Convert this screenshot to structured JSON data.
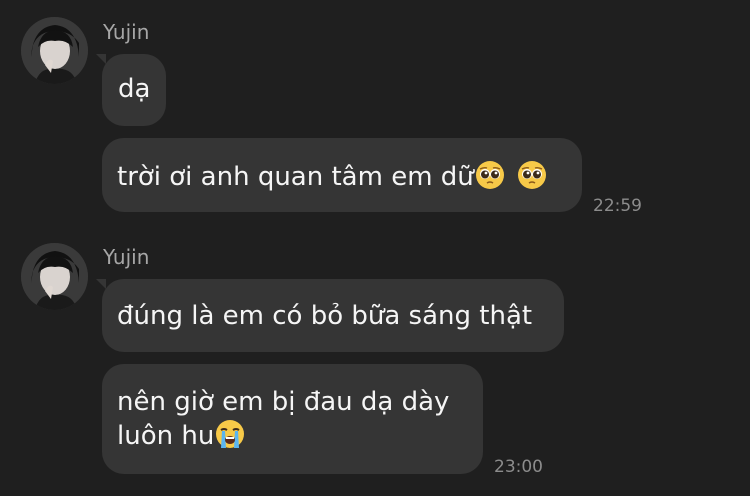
{
  "conversation": {
    "groups": [
      {
        "sender": "Yujin",
        "messages": [
          {
            "text": "dạ"
          },
          {
            "text": "trời ơi anh quan tâm em dữ",
            "emojis": [
              "pleading-face",
              "pleading-face"
            ],
            "time": "22:59"
          }
        ]
      },
      {
        "sender": "Yujin",
        "messages": [
          {
            "text": "đúng là em có bỏ bữa sáng thật"
          },
          {
            "line1": "nên giờ em bị đau dạ dày",
            "line2": "luôn hu",
            "emojis": [
              "loudly-crying-face"
            ],
            "time": "23:00"
          }
        ]
      }
    ]
  },
  "colors": {
    "background": "#1f1f1f",
    "bubble": "#353535",
    "sender_name": "#a6a6a6",
    "timestamp": "#8c8c8c",
    "text": "#f5f5f5"
  }
}
